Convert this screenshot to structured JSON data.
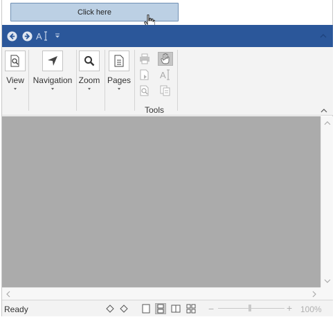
{
  "top_button": {
    "label": "Click here"
  },
  "ribbon": {
    "groups": [
      {
        "label": "View",
        "icon": "page-magnifier-icon"
      },
      {
        "label": "Navigation",
        "icon": "navigation-arrow-icon"
      },
      {
        "label": "Zoom",
        "icon": "zoom-icon"
      },
      {
        "label": "Pages",
        "icon": "pages-icon"
      }
    ],
    "tools_label": "Tools"
  },
  "status_bar": {
    "status_text": "Ready",
    "zoom_value": "100%"
  },
  "colors": {
    "accent": "#2b579a",
    "button_bg": "#bcd0e4",
    "document_bg": "#ababab"
  }
}
